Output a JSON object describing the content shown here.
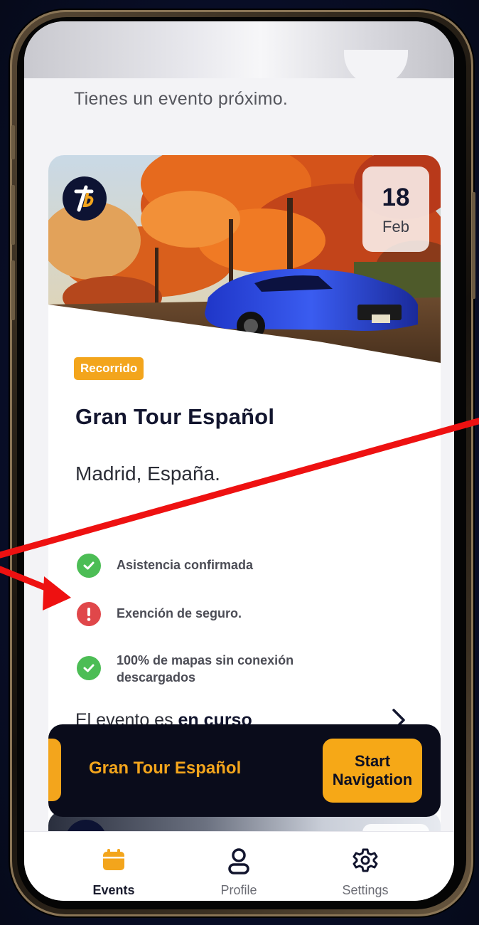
{
  "greeting": "Tienes un evento próximo.",
  "event": {
    "tag": "Recorrido",
    "title": "Gran Tour Español",
    "location": "Madrid, España.",
    "date_day": "18",
    "date_month": "Feb",
    "logo_text": "ħ",
    "statuses": [
      {
        "icon": "check-icon",
        "color": "#4cbd55",
        "text": "Asistencia confirmada"
      },
      {
        "icon": "exclamation-icon",
        "color": "#e0474a",
        "text": "Exención de seguro."
      },
      {
        "icon": "check-icon",
        "color": "#4cbd55",
        "text_line1": "100% de mapas sin conexión",
        "text_line2": "descargados"
      }
    ],
    "ongoing_prefix": "El evento es ",
    "ongoing_bold": "en curso"
  },
  "banner": {
    "title": "Gran Tour Español",
    "button_line1": "Start",
    "button_line2": "Navigation"
  },
  "tabs": [
    {
      "label": "Events",
      "icon": "calendar-icon",
      "active": true
    },
    {
      "label": "Profile",
      "icon": "person-icon",
      "active": false
    },
    {
      "label": "Settings",
      "icon": "gear-icon",
      "active": false
    }
  ],
  "colors": {
    "accent": "#f3a51c",
    "navy": "#12152e",
    "success": "#4cbd55",
    "warning": "#e0474a",
    "annotation": "#ee1111"
  }
}
